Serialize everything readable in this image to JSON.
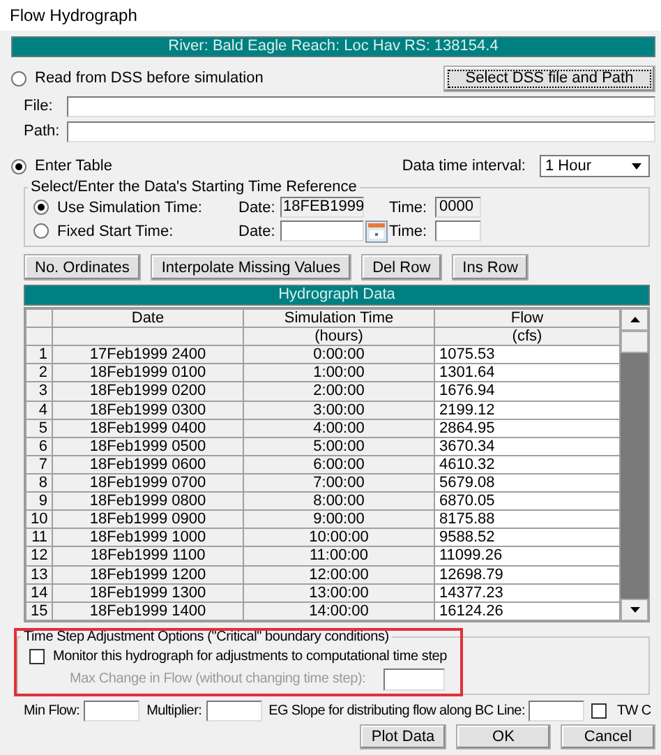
{
  "window": {
    "title": "Flow Hydrograph"
  },
  "location_bar": "River: Bald Eagle  Reach: Loc Hav  RS: 138154.4",
  "read_from_dss": {
    "label": "Read from DSS before simulation",
    "selected": false,
    "button": "Select DSS file and Path",
    "file_label": "File:",
    "path_label": "Path:"
  },
  "enter_table": {
    "label": "Enter Table",
    "selected": true
  },
  "data_time_interval": {
    "label": "Data time interval:",
    "value": "1 Hour"
  },
  "time_reference": {
    "legend": "Select/Enter the Data's Starting Time Reference",
    "options": [
      {
        "label": "Use Simulation Time:",
        "selected": true,
        "date_label": "Date:",
        "date": "18FEB1999",
        "time_label": "Time:",
        "time": "0000",
        "disabled": true,
        "calendar": false
      },
      {
        "label": "Fixed Start Time:",
        "selected": false,
        "date_label": "Date:",
        "time_label": "Time:",
        "disabled": false,
        "calendar": true
      }
    ]
  },
  "table_buttons": [
    "No. Ordinates",
    "Interpolate Missing Values",
    "Del Row",
    "Ins Row"
  ],
  "table": {
    "title": "Hydrograph Data",
    "columns": [
      {
        "label": "Date"
      },
      {
        "label": "Simulation Time",
        "unit": "(hours)"
      },
      {
        "label": "Flow",
        "unit": "(cfs)"
      }
    ],
    "rows": [
      {
        "number": "1",
        "date": "17Feb1999 2400",
        "time": "0:00:00",
        "flow": "1075.53"
      },
      {
        "number": "2",
        "date": "18Feb1999 0100",
        "time": "1:00:00",
        "flow": "1301.64"
      },
      {
        "number": "3",
        "date": "18Feb1999 0200",
        "time": "2:00:00",
        "flow": "1676.94"
      },
      {
        "number": "4",
        "date": "18Feb1999 0300",
        "time": "3:00:00",
        "flow": "2199.12"
      },
      {
        "number": "5",
        "date": "18Feb1999 0400",
        "time": "4:00:00",
        "flow": "2864.95"
      },
      {
        "number": "6",
        "date": "18Feb1999 0500",
        "time": "5:00:00",
        "flow": "3670.34"
      },
      {
        "number": "7",
        "date": "18Feb1999 0600",
        "time": "6:00:00",
        "flow": "4610.32"
      },
      {
        "number": "8",
        "date": "18Feb1999 0700",
        "time": "7:00:00",
        "flow": "5679.08"
      },
      {
        "number": "9",
        "date": "18Feb1999 0800",
        "time": "8:00:00",
        "flow": "6870.05"
      },
      {
        "number": "10",
        "date": "18Feb1999 0900",
        "time": "9:00:00",
        "flow": "8175.88"
      },
      {
        "number": "11",
        "date": "18Feb1999 1000",
        "time": "10:00:00",
        "flow": "9588.52"
      },
      {
        "number": "12",
        "date": "18Feb1999 1100",
        "time": "11:00:00",
        "flow": "11099.26"
      },
      {
        "number": "13",
        "date": "18Feb1999 1200",
        "time": "12:00:00",
        "flow": "12698.79"
      },
      {
        "number": "14",
        "date": "18Feb1999 1300",
        "time": "13:00:00",
        "flow": "14377.23"
      },
      {
        "number": "15",
        "date": "18Feb1999 1400",
        "time": "14:00:00",
        "flow": "16124.26"
      }
    ]
  },
  "time_step_options": {
    "legend": "Time Step Adjustment Options (\"Critical\" boundary conditions)",
    "highlighted": true,
    "monitor": {
      "label": "Monitor this hydrograph for adjustments to computational time step",
      "checked": false
    },
    "max_change": {
      "label": "Max Change in Flow (without changing time step):",
      "disabled": true
    }
  },
  "bottom_fields": [
    {
      "label": "Min Flow:"
    },
    {
      "label": "Multiplier:"
    },
    {
      "label": "EG Slope for distributing flow along BC Line:"
    }
  ],
  "tw_check": {
    "label": "TW C",
    "checked": false
  },
  "buttons": [
    "Plot Data",
    "OK",
    "Cancel"
  ]
}
